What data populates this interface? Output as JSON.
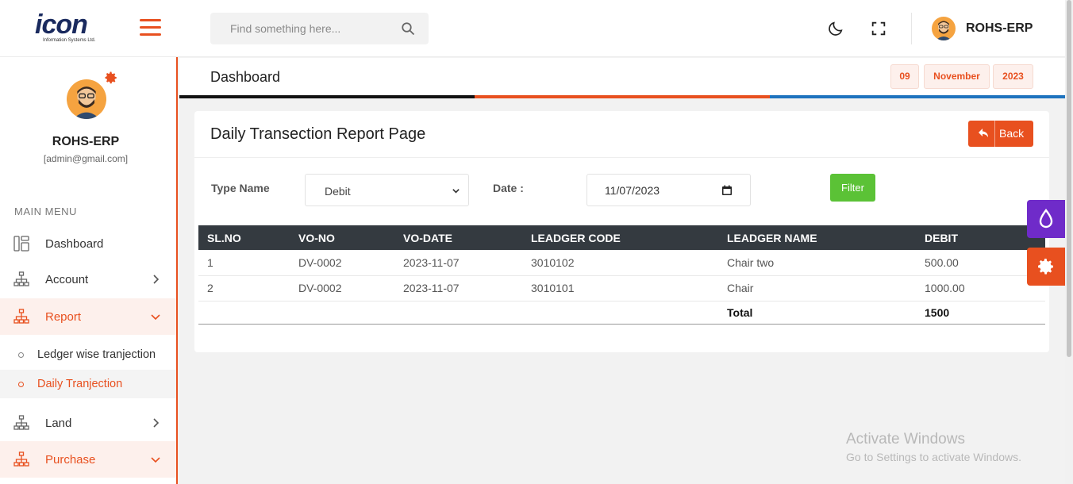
{
  "topbar": {
    "logo_text": "icon",
    "logo_sub": "Information Systems Ltd.",
    "search_placeholder": "Find something here...",
    "username": "ROHS-ERP"
  },
  "sidebar": {
    "name": "ROHS-ERP",
    "email": "[admin@gmail.com]",
    "menu_title": "MAIN MENU",
    "items": [
      {
        "label": "Dashboard"
      },
      {
        "label": "Account"
      },
      {
        "label": "Report"
      },
      {
        "label": "Land"
      },
      {
        "label": "Purchase"
      }
    ],
    "report_sub": [
      {
        "label": "Ledger wise tranjection"
      },
      {
        "label": "Daily Tranjection"
      }
    ]
  },
  "header": {
    "title": "Dashboard",
    "day": "09",
    "month": "November",
    "year": "2023",
    "bar_colors": [
      "#111111",
      "#e8501f",
      "#1e73be"
    ]
  },
  "card": {
    "title": "Daily Transection Report Page",
    "back_label": "Back",
    "filters": {
      "type_label": "Type Name",
      "type_value": "Debit",
      "type_options": [
        "Debit"
      ],
      "date_label": "Date :",
      "date_value": "11/07/2023",
      "filter_label": "Filter"
    }
  },
  "table": {
    "headers": [
      "SL.NO",
      "VO-NO",
      "VO-DATE",
      "LEADGER CODE",
      "LEADGER NAME",
      "DEBIT"
    ],
    "rows": [
      [
        "1",
        "DV-0002",
        "2023-11-07",
        "3010102",
        "Chair two",
        "500.00"
      ],
      [
        "2",
        "DV-0002",
        "2023-11-07",
        "3010101",
        "Chair",
        "1000.00"
      ]
    ],
    "total_label": "Total",
    "total_value": "1500"
  },
  "watermark": {
    "line1": "Activate Windows",
    "line2": "Go to Settings to activate Windows."
  },
  "colors": {
    "accent": "#e8501f",
    "filter": "#5bc236",
    "theme_btn": "#6f2bc9",
    "table_head": "#343a40"
  }
}
